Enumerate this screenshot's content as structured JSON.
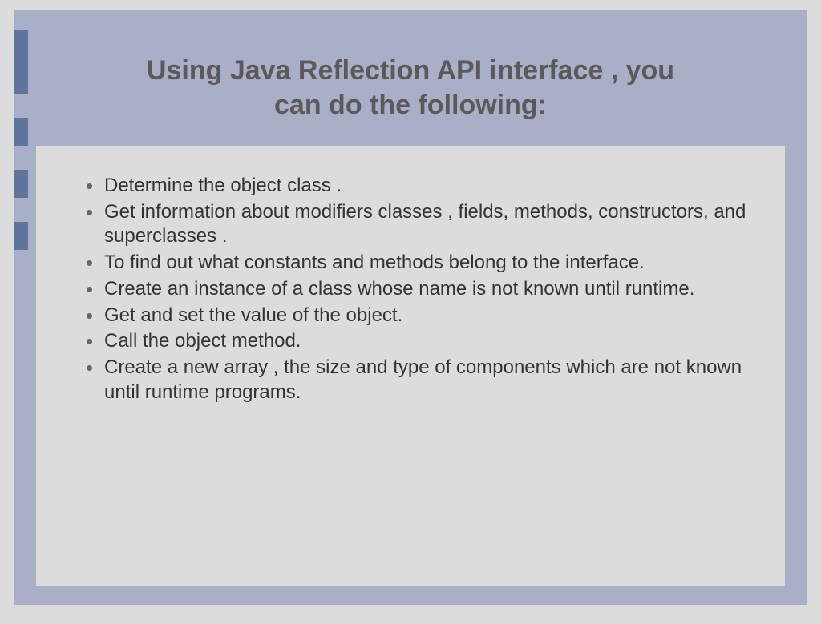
{
  "slide": {
    "title_line1": "Using Java Reflection API interface , you",
    "title_line2": "can do the following:",
    "bullets": [
      "Determine the object class .",
      "Get information about modifiers classes , fields, methods, constructors, and superclasses .",
      "To find out what constants and methods belong to the interface.",
      "Create an instance of a class whose name is not known until runtime.",
      "Get and set the value of the object.",
      "Call the object method.",
      "Create a new array , the size and type of components which are not known until runtime programs."
    ]
  }
}
